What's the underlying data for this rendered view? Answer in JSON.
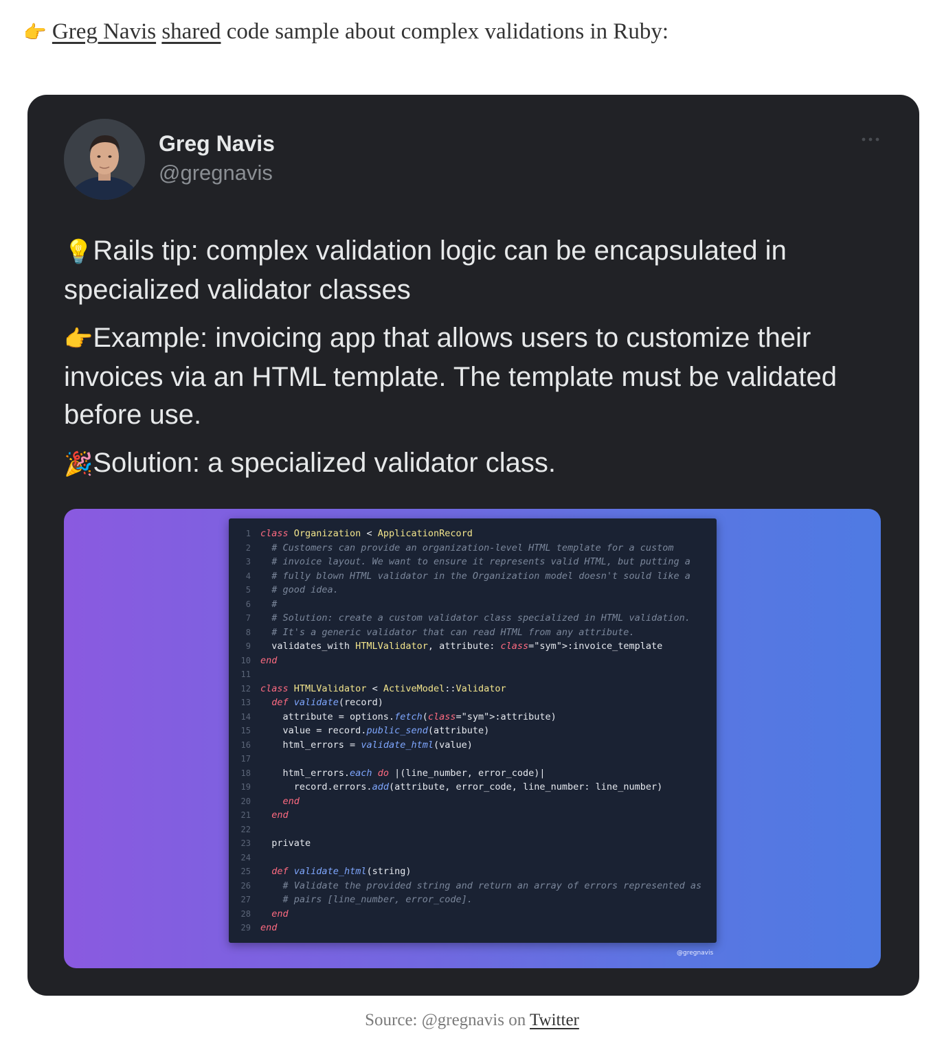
{
  "intro": {
    "pointer_emoji": "👉",
    "author_link": "Greg Navis",
    "shared_link": "shared",
    "rest": "code sample about complex validations in Ruby:"
  },
  "tweet": {
    "author_name": "Greg Navis",
    "author_handle": "@gregnavis",
    "more_icon": "more-horizontal-icon",
    "paragraphs": [
      {
        "emoji": "💡",
        "text": "Rails tip: complex validation logic can be encapsulated in specialized validator classes"
      },
      {
        "emoji": "👉",
        "text": "Example: invoicing app that allows users to customize their invoices via an HTML template. The template must be validated before use."
      },
      {
        "emoji": "🎉",
        "text": "Solution: a specialized validator class."
      }
    ],
    "media": {
      "watermark": "@gregnavis",
      "colors": {
        "gradient_start": "#8a5ae0",
        "gradient_end": "#4f7ae3",
        "code_bg": "#1a2233"
      },
      "code_lines": [
        {
          "n": "1",
          "t": "class Organization < ApplicationRecord"
        },
        {
          "n": "2",
          "t": "  # Customers can provide an organization-level HTML template for a custom"
        },
        {
          "n": "3",
          "t": "  # invoice layout. We want to ensure it represents valid HTML, but putting a"
        },
        {
          "n": "4",
          "t": "  # fully blown HTML validator in the Organization model doesn't sould like a"
        },
        {
          "n": "5",
          "t": "  # good idea."
        },
        {
          "n": "6",
          "t": "  #"
        },
        {
          "n": "7",
          "t": "  # Solution: create a custom validator class specialized in HTML validation."
        },
        {
          "n": "8",
          "t": "  # It's a generic validator that can read HTML from any attribute."
        },
        {
          "n": "9",
          "t": "  validates_with HTMLValidator, attribute: :invoice_template"
        },
        {
          "n": "10",
          "t": "end"
        },
        {
          "n": "11",
          "t": ""
        },
        {
          "n": "12",
          "t": "class HTMLValidator < ActiveModel::Validator"
        },
        {
          "n": "13",
          "t": "  def validate(record)"
        },
        {
          "n": "14",
          "t": "    attribute = options.fetch(:attribute)"
        },
        {
          "n": "15",
          "t": "    value = record.public_send(attribute)"
        },
        {
          "n": "16",
          "t": "    html_errors = validate_html(value)"
        },
        {
          "n": "17",
          "t": ""
        },
        {
          "n": "18",
          "t": "    html_errors.each do |(line_number, error_code)|"
        },
        {
          "n": "19",
          "t": "      record.errors.add(attribute, error_code, line_number: line_number)"
        },
        {
          "n": "20",
          "t": "    end"
        },
        {
          "n": "21",
          "t": "  end"
        },
        {
          "n": "22",
          "t": ""
        },
        {
          "n": "23",
          "t": "  private"
        },
        {
          "n": "24",
          "t": ""
        },
        {
          "n": "25",
          "t": "  def validate_html(string)"
        },
        {
          "n": "26",
          "t": "    # Validate the provided string and return an array of errors represented as"
        },
        {
          "n": "27",
          "t": "    # pairs [line_number, error_code]."
        },
        {
          "n": "28",
          "t": "  end"
        },
        {
          "n": "29",
          "t": "end"
        }
      ]
    }
  },
  "caption": {
    "prefix": "Source: @gregnavis on",
    "link": "Twitter"
  }
}
